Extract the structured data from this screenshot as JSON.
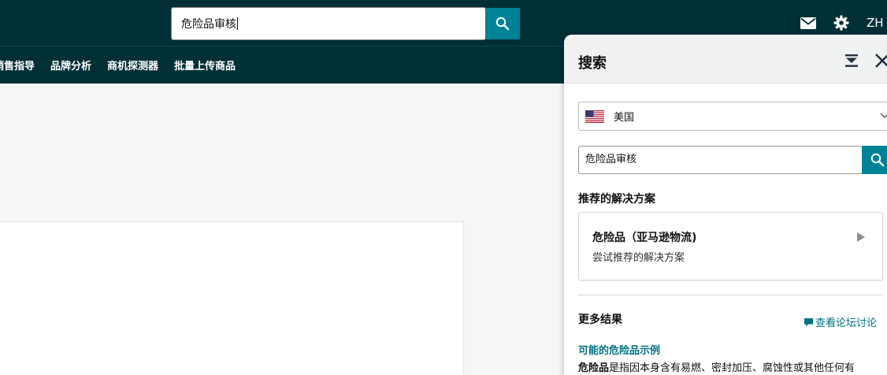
{
  "header": {
    "search_value": "危险品审核",
    "language": "ZH"
  },
  "nav": {
    "items": [
      {
        "label": "销售指导"
      },
      {
        "label": "品牌分析"
      },
      {
        "label": "商机探测器"
      },
      {
        "label": "批量上传商品"
      }
    ]
  },
  "panel": {
    "title": "搜索",
    "country": "美国",
    "search_value": "危险品审核",
    "recommended_heading": "推荐的解决方案",
    "recommended": {
      "title": "危险品（亚马逊物流)",
      "subtitle": "尝试推荐的解决方案"
    },
    "more_results_heading": "更多结果",
    "forum_link": "查看论坛讨论",
    "result": {
      "title": "可能的危险品示例",
      "term": "危险品",
      "text": "是指因本身含有易燃、密封加压、腐蚀性或其他任何有"
    }
  },
  "colors": {
    "header_bg": "#002f36",
    "accent": "#008296",
    "link": "#007185"
  }
}
